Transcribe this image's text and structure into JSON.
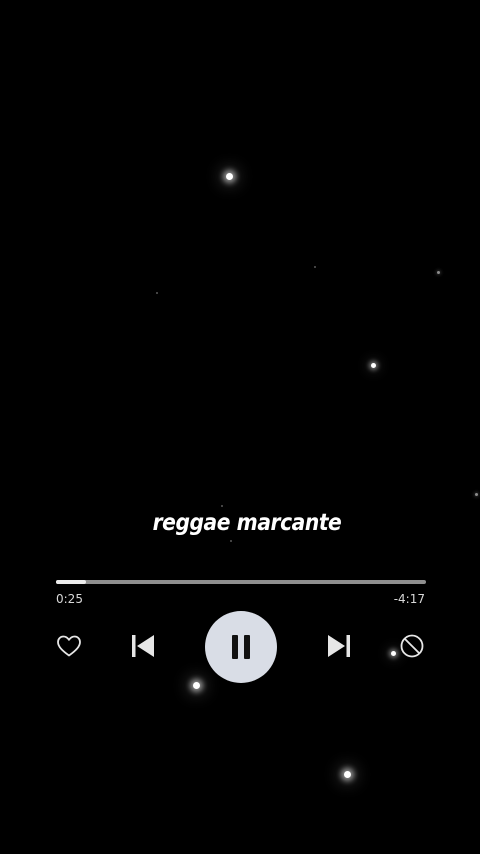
{
  "player": {
    "song_title": "reggae marcante",
    "elapsed_time": "0:25",
    "remaining_time": "-4:17",
    "progress_fraction": 0.08
  },
  "controls": {
    "like": "heart-icon",
    "previous": "skip-previous-icon",
    "play_pause": "pause-icon",
    "next": "skip-next-icon",
    "block": "block-icon"
  },
  "colors": {
    "background": "#000000",
    "progress_fill": "#ececec",
    "progress_track": "#8f8f8f",
    "play_button": "#d9dde6",
    "icon": "#e6e6e6"
  }
}
